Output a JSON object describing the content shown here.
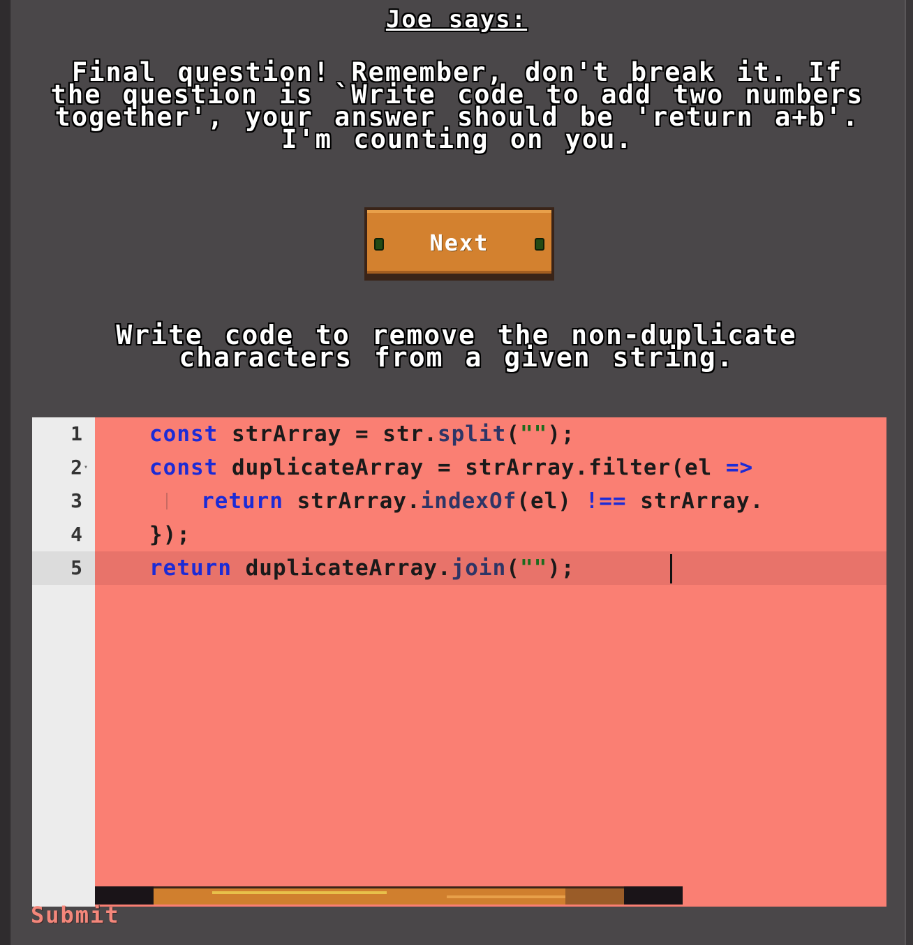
{
  "dialog": {
    "speaker": "Joe says:",
    "message": "Final question! Remember, don't break it. If the question is `Write code to add two numbers together', your answer should be 'return a+b'. I'm counting on you.",
    "next_label": "Next"
  },
  "question": "Write code to remove the non-duplicate characters from a given string.",
  "editor": {
    "line_numbers": [
      "1",
      "2",
      "3",
      "4",
      "5"
    ],
    "lines": [
      [
        {
          "t": "const",
          "c": "kw"
        },
        {
          "t": " strArray = str.",
          "c": ""
        },
        {
          "t": "split",
          "c": "fn"
        },
        {
          "t": "(",
          "c": ""
        },
        {
          "t": "\"\"",
          "c": "str"
        },
        {
          "t": ");",
          "c": ""
        }
      ],
      [
        {
          "t": "const",
          "c": "kw"
        },
        {
          "t": " duplicateArray = strArray.filter(el ",
          "c": ""
        },
        {
          "t": "=>",
          "c": "op"
        }
      ],
      [
        {
          "t": "return",
          "c": "kw"
        },
        {
          "t": " strArray.",
          "c": ""
        },
        {
          "t": "indexOf",
          "c": "fn"
        },
        {
          "t": "(el) ",
          "c": ""
        },
        {
          "t": "!==",
          "c": "op"
        },
        {
          "t": " strArray.",
          "c": ""
        }
      ],
      [
        {
          "t": "});",
          "c": ""
        }
      ],
      [
        {
          "t": "return",
          "c": "kw"
        },
        {
          "t": " duplicateArray.",
          "c": ""
        },
        {
          "t": "join",
          "c": "fn"
        },
        {
          "t": "(",
          "c": ""
        },
        {
          "t": "\"\"",
          "c": "str"
        },
        {
          "t": ");",
          "c": ""
        }
      ]
    ],
    "active_line": 5
  },
  "submit_label": "Submit",
  "colors": {
    "background": "#4a4749",
    "editor_background": "#fa7f73",
    "keyword": "#1c2bd6",
    "submit": "#f4877b",
    "button_wood": "#d3812f"
  },
  "icons": {
    "fold": "fold-arrow-icon",
    "nail": "nail-icon"
  }
}
